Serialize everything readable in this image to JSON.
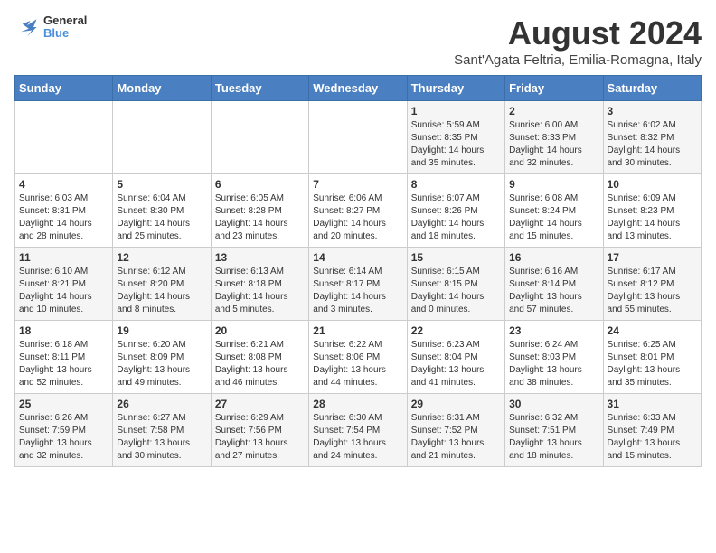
{
  "header": {
    "logo_line1": "General",
    "logo_line2": "Blue",
    "month_year": "August 2024",
    "location": "Sant'Agata Feltria, Emilia-Romagna, Italy"
  },
  "days_of_week": [
    "Sunday",
    "Monday",
    "Tuesday",
    "Wednesday",
    "Thursday",
    "Friday",
    "Saturday"
  ],
  "weeks": [
    [
      {
        "day": "",
        "info": ""
      },
      {
        "day": "",
        "info": ""
      },
      {
        "day": "",
        "info": ""
      },
      {
        "day": "",
        "info": ""
      },
      {
        "day": "1",
        "info": "Sunrise: 5:59 AM\nSunset: 8:35 PM\nDaylight: 14 hours and 35 minutes."
      },
      {
        "day": "2",
        "info": "Sunrise: 6:00 AM\nSunset: 8:33 PM\nDaylight: 14 hours and 32 minutes."
      },
      {
        "day": "3",
        "info": "Sunrise: 6:02 AM\nSunset: 8:32 PM\nDaylight: 14 hours and 30 minutes."
      }
    ],
    [
      {
        "day": "4",
        "info": "Sunrise: 6:03 AM\nSunset: 8:31 PM\nDaylight: 14 hours and 28 minutes."
      },
      {
        "day": "5",
        "info": "Sunrise: 6:04 AM\nSunset: 8:30 PM\nDaylight: 14 hours and 25 minutes."
      },
      {
        "day": "6",
        "info": "Sunrise: 6:05 AM\nSunset: 8:28 PM\nDaylight: 14 hours and 23 minutes."
      },
      {
        "day": "7",
        "info": "Sunrise: 6:06 AM\nSunset: 8:27 PM\nDaylight: 14 hours and 20 minutes."
      },
      {
        "day": "8",
        "info": "Sunrise: 6:07 AM\nSunset: 8:26 PM\nDaylight: 14 hours and 18 minutes."
      },
      {
        "day": "9",
        "info": "Sunrise: 6:08 AM\nSunset: 8:24 PM\nDaylight: 14 hours and 15 minutes."
      },
      {
        "day": "10",
        "info": "Sunrise: 6:09 AM\nSunset: 8:23 PM\nDaylight: 14 hours and 13 minutes."
      }
    ],
    [
      {
        "day": "11",
        "info": "Sunrise: 6:10 AM\nSunset: 8:21 PM\nDaylight: 14 hours and 10 minutes."
      },
      {
        "day": "12",
        "info": "Sunrise: 6:12 AM\nSunset: 8:20 PM\nDaylight: 14 hours and 8 minutes."
      },
      {
        "day": "13",
        "info": "Sunrise: 6:13 AM\nSunset: 8:18 PM\nDaylight: 14 hours and 5 minutes."
      },
      {
        "day": "14",
        "info": "Sunrise: 6:14 AM\nSunset: 8:17 PM\nDaylight: 14 hours and 3 minutes."
      },
      {
        "day": "15",
        "info": "Sunrise: 6:15 AM\nSunset: 8:15 PM\nDaylight: 14 hours and 0 minutes."
      },
      {
        "day": "16",
        "info": "Sunrise: 6:16 AM\nSunset: 8:14 PM\nDaylight: 13 hours and 57 minutes."
      },
      {
        "day": "17",
        "info": "Sunrise: 6:17 AM\nSunset: 8:12 PM\nDaylight: 13 hours and 55 minutes."
      }
    ],
    [
      {
        "day": "18",
        "info": "Sunrise: 6:18 AM\nSunset: 8:11 PM\nDaylight: 13 hours and 52 minutes."
      },
      {
        "day": "19",
        "info": "Sunrise: 6:20 AM\nSunset: 8:09 PM\nDaylight: 13 hours and 49 minutes."
      },
      {
        "day": "20",
        "info": "Sunrise: 6:21 AM\nSunset: 8:08 PM\nDaylight: 13 hours and 46 minutes."
      },
      {
        "day": "21",
        "info": "Sunrise: 6:22 AM\nSunset: 8:06 PM\nDaylight: 13 hours and 44 minutes."
      },
      {
        "day": "22",
        "info": "Sunrise: 6:23 AM\nSunset: 8:04 PM\nDaylight: 13 hours and 41 minutes."
      },
      {
        "day": "23",
        "info": "Sunrise: 6:24 AM\nSunset: 8:03 PM\nDaylight: 13 hours and 38 minutes."
      },
      {
        "day": "24",
        "info": "Sunrise: 6:25 AM\nSunset: 8:01 PM\nDaylight: 13 hours and 35 minutes."
      }
    ],
    [
      {
        "day": "25",
        "info": "Sunrise: 6:26 AM\nSunset: 7:59 PM\nDaylight: 13 hours and 32 minutes."
      },
      {
        "day": "26",
        "info": "Sunrise: 6:27 AM\nSunset: 7:58 PM\nDaylight: 13 hours and 30 minutes."
      },
      {
        "day": "27",
        "info": "Sunrise: 6:29 AM\nSunset: 7:56 PM\nDaylight: 13 hours and 27 minutes."
      },
      {
        "day": "28",
        "info": "Sunrise: 6:30 AM\nSunset: 7:54 PM\nDaylight: 13 hours and 24 minutes."
      },
      {
        "day": "29",
        "info": "Sunrise: 6:31 AM\nSunset: 7:52 PM\nDaylight: 13 hours and 21 minutes."
      },
      {
        "day": "30",
        "info": "Sunrise: 6:32 AM\nSunset: 7:51 PM\nDaylight: 13 hours and 18 minutes."
      },
      {
        "day": "31",
        "info": "Sunrise: 6:33 AM\nSunset: 7:49 PM\nDaylight: 13 hours and 15 minutes."
      }
    ]
  ]
}
